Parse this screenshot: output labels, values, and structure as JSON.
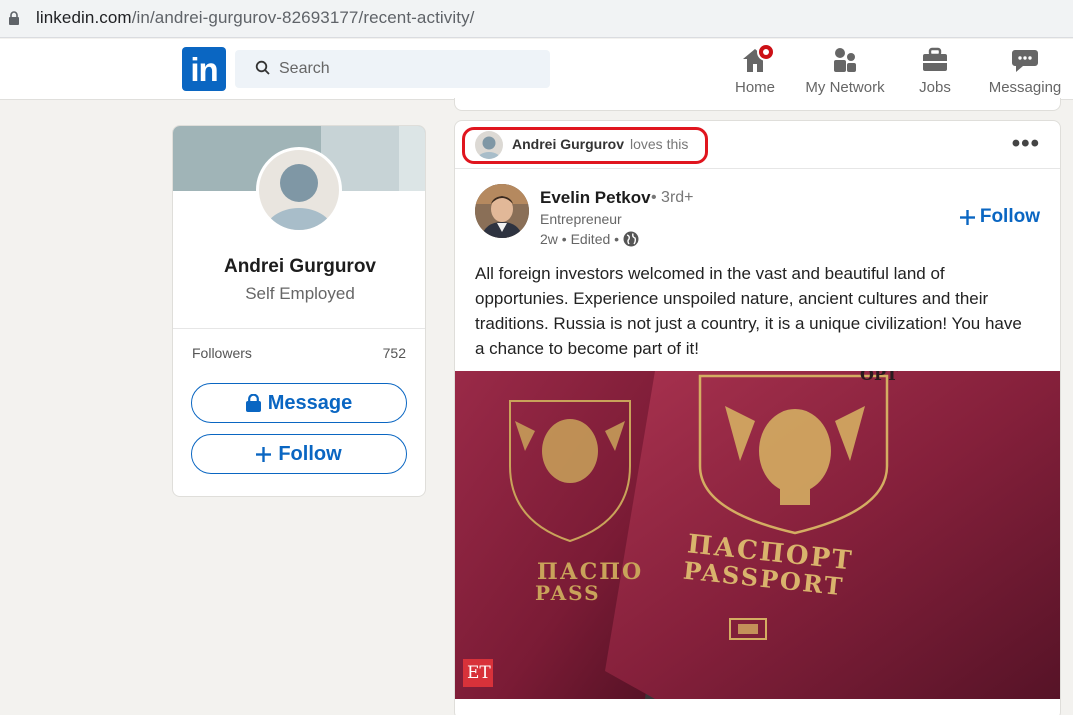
{
  "browser": {
    "url_host": "linkedin.com",
    "url_path": "/in/andrei-gurgurov-82693177/recent-activity/"
  },
  "nav": {
    "logo_text": "in",
    "search_placeholder": "Search",
    "items": [
      {
        "label": "Home",
        "icon": "home-icon",
        "has_badge": true
      },
      {
        "label": "My Network",
        "icon": "network-icon"
      },
      {
        "label": "Jobs",
        "icon": "briefcase-icon"
      },
      {
        "label": "Messaging",
        "icon": "messaging-icon"
      }
    ]
  },
  "profile": {
    "name": "Andrei Gurgurov",
    "headline": "Self Employed",
    "followers_label": "Followers",
    "followers_count": "752",
    "message_label": "Message",
    "follow_label": "Follow"
  },
  "post": {
    "actor_name": "Andrei Gurgurov",
    "actor_action": "loves this",
    "author_name": "Evelin Petkov",
    "author_degree": "• 3rd+",
    "author_headline": "Entrepreneur",
    "author_meta": "2w • Edited •",
    "follow_label": "Follow",
    "text": "All foreign investors welcomed in the vast and beautiful land of opportunies. Experience unspoiled nature, ancient cultures and their traditions. Russia is not just a country, it is a unique civilization! You have a chance to become part of it!",
    "image": {
      "passport_text_ru": "ПАСПОРТ",
      "passport_text_en": "PASSPORT",
      "passport_text_ru_partial": "ПАСПО",
      "passport_text_en_partial": "PASS",
      "top_text_partial": "ОРТ",
      "watermark": "ET"
    }
  },
  "colors": {
    "brand": "#0a66c2",
    "highlight": "#e0151e",
    "badge": "#cc1016",
    "passport": "#7a1b35"
  }
}
